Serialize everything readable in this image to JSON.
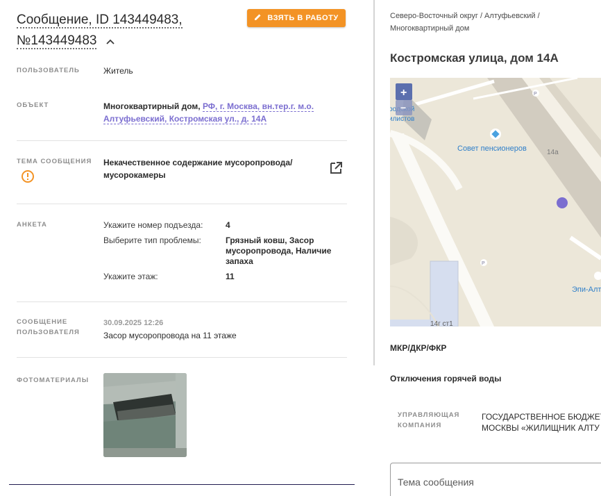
{
  "header": {
    "title_line1": "Сообщение, ID 143449483,",
    "title_line2": "№143449483",
    "take_button": "ВЗЯТЬ В РАБОТУ"
  },
  "fields": {
    "user": {
      "label": "ПОЛЬЗОВАТЕЛЬ",
      "value": "Житель"
    },
    "object": {
      "label": "ОБЪЕКТ",
      "type": "Многоквартирный дом,",
      "link_line1": "РФ, г. Москва, вн.тер.г. м.о.",
      "link_line2": "Алтуфьевский, Костромская ул., д. 14А"
    },
    "topic": {
      "label": "ТЕМА СООБЩЕНИЯ",
      "line1": "Некачественное содержание мусоропровода/",
      "line2": "мусорокамеры"
    },
    "survey": {
      "label": "АНКЕТА",
      "items": [
        {
          "question": "Укажите номер подъезда:",
          "answer": "4"
        },
        {
          "question": "Выберите тип проблемы:",
          "answer_lines": [
            "Грязный ковш, Засор",
            "мусоропровода, Наличие",
            "запаха"
          ]
        },
        {
          "question": "Укажите этаж:",
          "answer": "11"
        }
      ]
    },
    "message": {
      "label_line1": "СООБЩЕНИЕ",
      "label_line2": "ПОЛЬЗОВАТЕЛЯ",
      "date": "30.09.2025 12:26",
      "text": "Засор мусоропровода на 11 этаже"
    },
    "photos": {
      "label": "ФОТОМАТЕРИАЛЫ"
    }
  },
  "right": {
    "breadcrumb_line1": "Северо-Восточный округ / Алтуфьевский /",
    "breadcrumb_line2": "Многоквартирный дом",
    "address": "Костромская улица, дом 14А",
    "map": {
      "zoom_in": "+",
      "zoom_out": "−",
      "label_council": "Совет пенсионеров",
      "label_14a": "14а",
      "label_14g": "14г ст1",
      "label_epi": "Эпи-Алт",
      "label_partial1": "родской",
      "label_partial2": "илистов",
      "parking": "P"
    },
    "mkr": "МКР/ДКР/ФКР",
    "hot_water": "Отключения горячей воды",
    "uk_label_line1": "УПРАВЛЯЮЩАЯ",
    "uk_label_line2": "КОМПАНИЯ",
    "uk_value_line1": "ГОСУДАРСТВЕННОЕ БЮДЖЕТ",
    "uk_value_line2": "МОСКВЫ «ЖИЛИЩНИК АЛТУ",
    "topic_placeholder": "Тема сообщения"
  },
  "colors": {
    "accent": "#f39325",
    "link": "#7b6ed0",
    "warning": "#f39325",
    "map_marker": "#7b6ed0"
  }
}
